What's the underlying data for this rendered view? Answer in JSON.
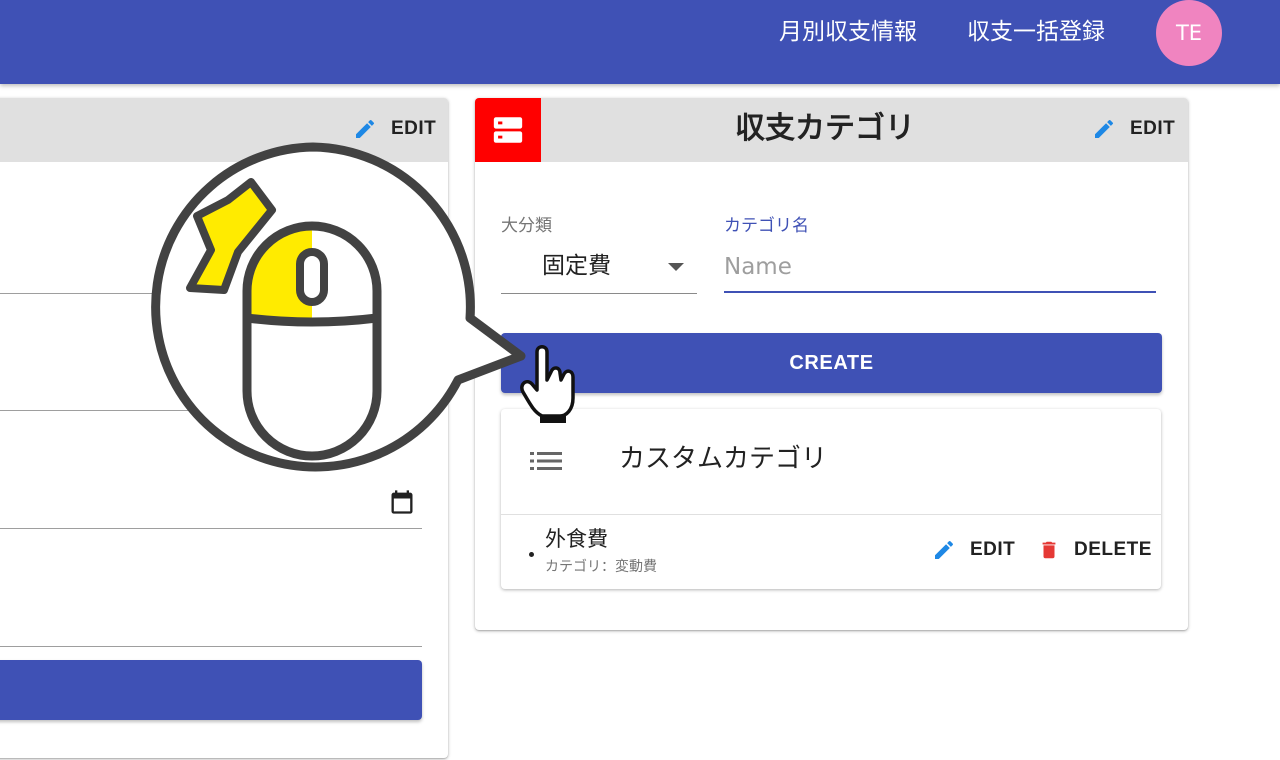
{
  "header": {
    "nav": [
      "月別収支情報",
      "収支一括登録"
    ],
    "avatar_initials": "TE",
    "background_color": "#3f51b5",
    "avatar_color": "#f084c0"
  },
  "left_card": {
    "edit_label": "EDIT"
  },
  "category_card": {
    "title": "収支カテゴリ",
    "edit_label": "EDIT",
    "icon": "storage-icon",
    "icon_color": "#ff0000",
    "form": {
      "major_label": "大分類",
      "major_value": "固定費",
      "name_label": "カテゴリ名",
      "name_placeholder": "Name",
      "name_value": ""
    },
    "create_label": "CREATE",
    "list": {
      "title": "カスタムカテゴリ",
      "icon": "list-icon",
      "items": [
        {
          "name": "外食費",
          "sub": "カテゴリ：変動費",
          "edit_label": "EDIT",
          "delete_label": "DELETE"
        }
      ]
    }
  },
  "colors": {
    "primary": "#3f51b5",
    "edit_icon": "#1e88e5",
    "delete_icon": "#e53935",
    "mouse_highlight": "#ffeb00",
    "outline": "#424242"
  }
}
